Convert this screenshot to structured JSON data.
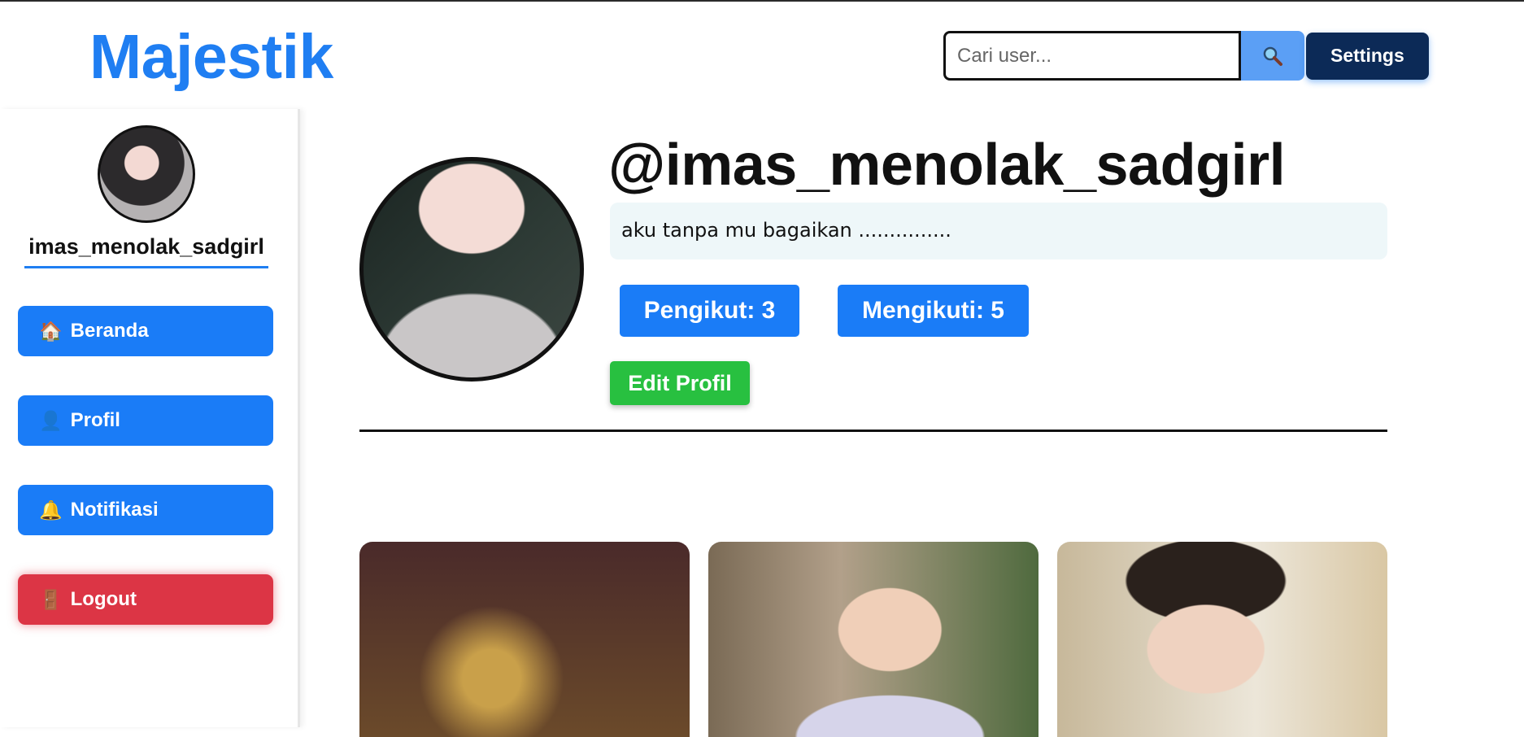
{
  "header": {
    "logo": "Majestik",
    "search": {
      "placeholder": "Cari user...",
      "value": ""
    },
    "search_icon": "magnifier-icon",
    "settings_label": "Settings"
  },
  "sidebar": {
    "username": "imas_menolak_sadgirl",
    "items": [
      {
        "icon": "🏠",
        "label": "Beranda"
      },
      {
        "icon": "👤",
        "label": "Profil"
      },
      {
        "icon": "🔔",
        "label": "Notifikasi"
      },
      {
        "icon": "🚪",
        "label": "Logout"
      }
    ]
  },
  "profile": {
    "handle": "@imas_menolak_sadgirl",
    "bio": "aku tanpa mu bagaikan ...............",
    "followers_label": "Pengikut: 3",
    "following_label": "Mengikuti: 5",
    "edit_label": "Edit Profil"
  },
  "colors": {
    "accent": "#1a7cf7",
    "logout": "#dc3545",
    "edit": "#28c040",
    "settings": "#0c2a57"
  }
}
